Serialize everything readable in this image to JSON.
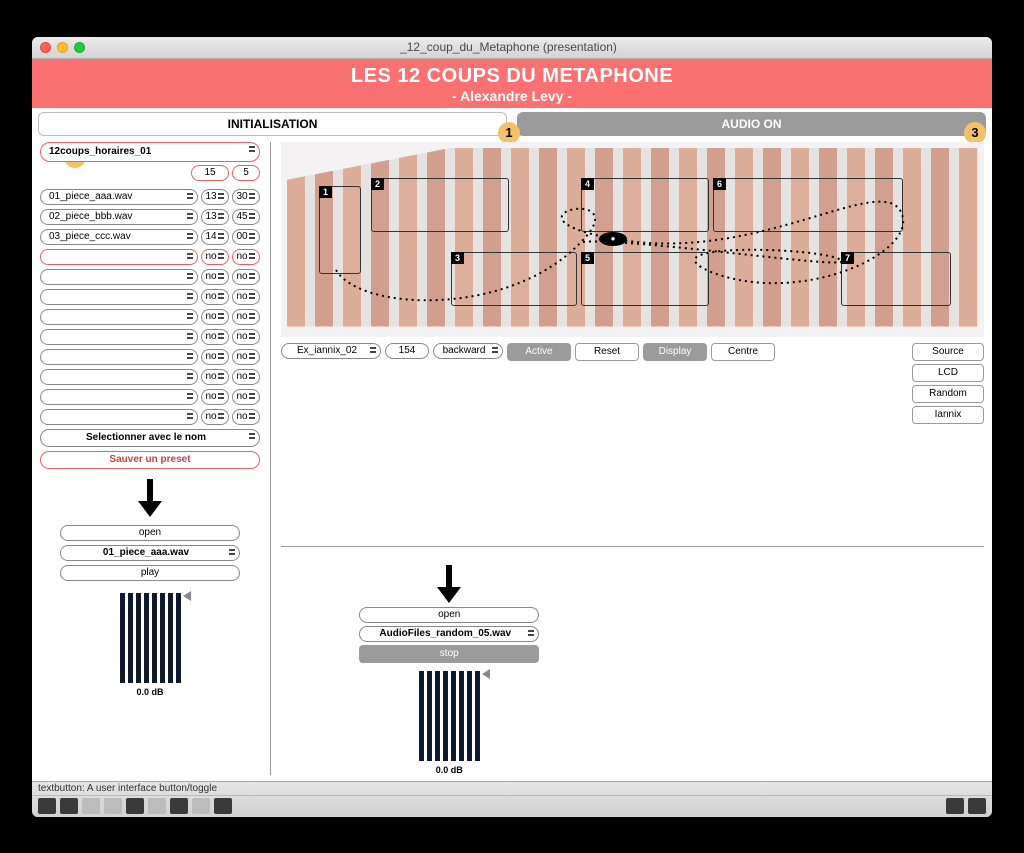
{
  "window": {
    "title": "_12_coup_du_Metaphone (presentation)"
  },
  "header": {
    "title": "LES 12 COUPS DU METAPHONE",
    "subtitle": "- Alexandre Levy -"
  },
  "tabs": {
    "init": "INITIALISATION",
    "audio": "AUDIO ON"
  },
  "badges": {
    "b1": "1",
    "b2": "2",
    "b3": "3"
  },
  "preset": {
    "selected": "12coups_horaires_01",
    "time_a": "15",
    "time_b": "5"
  },
  "pieces": [
    {
      "file": "01_piece_aaa.wav",
      "h": "13",
      "m": "30"
    },
    {
      "file": "02_piece_bbb.wav",
      "h": "13",
      "m": "45"
    },
    {
      "file": "03_piece_ccc.wav",
      "h": "14",
      "m": "00"
    },
    {
      "file": "",
      "h": "no",
      "m": "no"
    },
    {
      "file": "",
      "h": "no",
      "m": "no"
    },
    {
      "file": "",
      "h": "no",
      "m": "no"
    },
    {
      "file": "",
      "h": "no",
      "m": "no"
    },
    {
      "file": "",
      "h": "no",
      "m": "no"
    },
    {
      "file": "",
      "h": "no",
      "m": "no"
    },
    {
      "file": "",
      "h": "no",
      "m": "no"
    },
    {
      "file": "",
      "h": "no",
      "m": "no"
    },
    {
      "file": "",
      "h": "no",
      "m": "no"
    }
  ],
  "preset_actions": {
    "select_label": "Selectionner avec le nom",
    "save_label": "Sauver un preset"
  },
  "player_left": {
    "open": "open",
    "file": "01_piece_aaa.wav",
    "play": "play",
    "db": "0.0 dB"
  },
  "player_right": {
    "open": "open",
    "file": "AudioFiles_random_05.wav",
    "stop": "stop",
    "db": "0.0 dB"
  },
  "traj": {
    "preset": "Ex_iannix_02",
    "speed": "154",
    "direction": "backward",
    "active": "Active",
    "reset": "Reset",
    "display": "Display",
    "centre": "Centre",
    "src": "Source",
    "lcd": "LCD",
    "random": "Random",
    "iannix": "Iannix"
  },
  "zones": {
    "z1": "1",
    "z2": "2",
    "z3": "3",
    "z4": "4",
    "z5": "5",
    "z6": "6",
    "z7": "7"
  },
  "footer": {
    "status": "textbutton: A user interface button/toggle"
  }
}
